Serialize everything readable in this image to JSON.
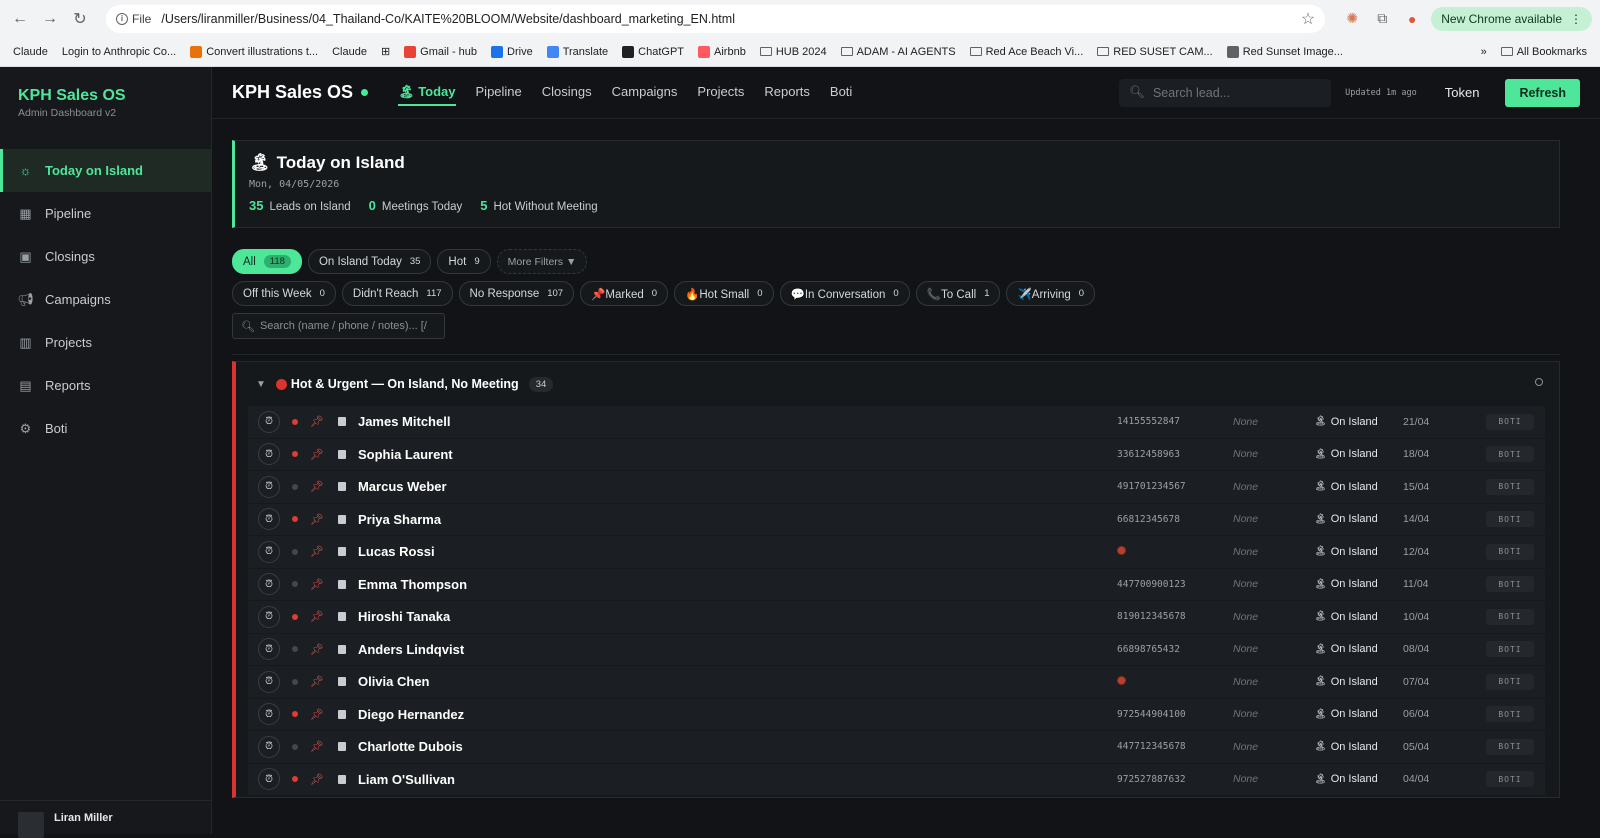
{
  "browser": {
    "file_label": "File",
    "url": "/Users/liranmiller/Business/04_Thailand-Co/KAITE%20BLOOM/Website/dashboard_marketing_EN.html",
    "new_chrome": "New Chrome available",
    "bookmarks": [
      "Claude",
      "Login to Anthropic Co...",
      "Convert illustrations t...",
      "Claude",
      "Gmail - hub",
      "Drive",
      "Translate",
      "ChatGPT",
      "Airbnb",
      "HUB 2024",
      "ADAM - AI AGENTS",
      "Red Ace Beach Vi...",
      "RED SUSET CAM...",
      "Red Sunset Image..."
    ],
    "all_bookmarks": "All Bookmarks"
  },
  "sidebar": {
    "brand": "KPH Sales OS",
    "subtitle": "Admin Dashboard v2",
    "items": [
      {
        "label": "Today on Island",
        "icon": "sun-icon"
      },
      {
        "label": "Pipeline",
        "icon": "grid-icon"
      },
      {
        "label": "Closings",
        "icon": "cash-icon"
      },
      {
        "label": "Campaigns",
        "icon": "megaphone-icon"
      },
      {
        "label": "Projects",
        "icon": "building-icon"
      },
      {
        "label": "Reports",
        "icon": "chart-icon"
      },
      {
        "label": "Boti",
        "icon": "robot-icon"
      }
    ],
    "user": "Liran Miller"
  },
  "topbar": {
    "title": "KPH Sales OS",
    "tabs": [
      "Today",
      "Pipeline",
      "Closings",
      "Campaigns",
      "Projects",
      "Reports",
      "Boti"
    ],
    "search_placeholder": "Search lead...",
    "updated": "Updated 1m ago",
    "token": "Token",
    "refresh": "Refresh"
  },
  "today": {
    "title": "Today on Island",
    "date": "Mon, 04/05/2026",
    "stats": [
      {
        "num": "35",
        "label": "Leads on Island"
      },
      {
        "num": "0",
        "label": "Meetings Today"
      },
      {
        "num": "5",
        "label": "Hot Without Meeting"
      }
    ]
  },
  "filters": {
    "row1": [
      {
        "label": "All",
        "count": "118"
      },
      {
        "label": "On Island Today",
        "count": "35"
      },
      {
        "label": "Hot",
        "count": "9"
      }
    ],
    "more": "More Filters ▼",
    "row2": [
      {
        "label": "Off this Week",
        "count": "0"
      },
      {
        "label": "Didn't Reach",
        "count": "117"
      },
      {
        "label": "No Response",
        "count": "107"
      },
      {
        "label": "📌Marked",
        "count": "0"
      },
      {
        "label": "🔥Hot Small",
        "count": "0"
      },
      {
        "label": "💬In Conversation",
        "count": "0"
      },
      {
        "label": "📞To Call",
        "count": "1"
      },
      {
        "label": "✈️Arriving",
        "count": "0"
      }
    ],
    "search_placeholder": "Search (name / phone / notes)... [/"
  },
  "group": {
    "title": "Hot & Urgent — On Island, No Meeting",
    "count": "34",
    "rows": [
      {
        "name": "James Mitchell",
        "phone": "14155552847",
        "hot": true,
        "meeting": "None",
        "status": "On Island",
        "date": "21/04",
        "tag": "BOTI"
      },
      {
        "name": "Sophia Laurent",
        "phone": "33612458963",
        "hot": true,
        "meeting": "None",
        "status": "On Island",
        "date": "18/04",
        "tag": "BOTI"
      },
      {
        "name": "Marcus Weber",
        "phone": "491701234567",
        "hot": false,
        "meeting": "None",
        "status": "On Island",
        "date": "15/04",
        "tag": "BOTI"
      },
      {
        "name": "Priya Sharma",
        "phone": "66812345678",
        "hot": true,
        "meeting": "None",
        "status": "On Island",
        "date": "14/04",
        "tag": "BOTI"
      },
      {
        "name": "Lucas Rossi",
        "phone": "",
        "hot": false,
        "meeting": "None",
        "status": "On Island",
        "date": "12/04",
        "tag": "BOTI"
      },
      {
        "name": "Emma Thompson",
        "phone": "447700900123",
        "hot": false,
        "meeting": "None",
        "status": "On Island",
        "date": "11/04",
        "tag": "BOTI"
      },
      {
        "name": "Hiroshi Tanaka",
        "phone": "819012345678",
        "hot": true,
        "meeting": "None",
        "status": "On Island",
        "date": "10/04",
        "tag": "BOTI"
      },
      {
        "name": "Anders Lindqvist",
        "phone": "66898765432",
        "hot": false,
        "meeting": "None",
        "status": "On Island",
        "date": "08/04",
        "tag": "BOTI"
      },
      {
        "name": "Olivia Chen",
        "phone": "",
        "hot": false,
        "meeting": "None",
        "status": "On Island",
        "date": "07/04",
        "tag": "BOTI"
      },
      {
        "name": "Diego Hernandez",
        "phone": "972544904100",
        "hot": true,
        "meeting": "None",
        "status": "On Island",
        "date": "06/04",
        "tag": "BOTI"
      },
      {
        "name": "Charlotte Dubois",
        "phone": "447712345678",
        "hot": false,
        "meeting": "None",
        "status": "On Island",
        "date": "05/04",
        "tag": "BOTI"
      },
      {
        "name": "Liam O'Sullivan",
        "phone": "972527887632",
        "hot": true,
        "meeting": "None",
        "status": "On Island",
        "date": "04/04",
        "tag": "BOTI"
      }
    ]
  },
  "colors": {
    "accent": "#4ee79a",
    "hot": "#d9342f",
    "bg": "#111316"
  }
}
